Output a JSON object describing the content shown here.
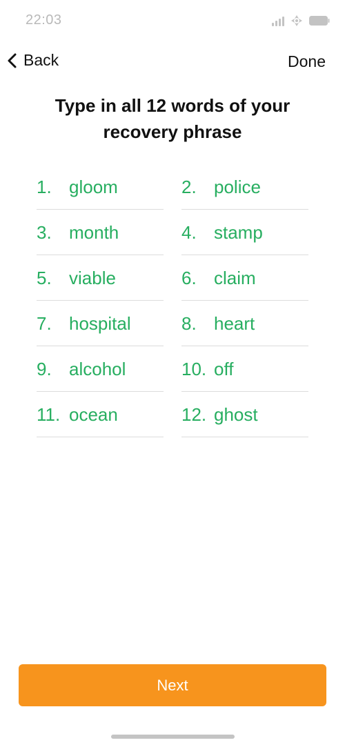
{
  "status_bar": {
    "time": "22:03"
  },
  "nav": {
    "back_label": "Back",
    "done_label": "Done"
  },
  "title": "Type in all 12 words of your recovery phrase",
  "words": [
    {
      "index": "1.",
      "word": "gloom"
    },
    {
      "index": "2.",
      "word": "police"
    },
    {
      "index": "3.",
      "word": "month"
    },
    {
      "index": "4.",
      "word": "stamp"
    },
    {
      "index": "5.",
      "word": "viable"
    },
    {
      "index": "6.",
      "word": "claim"
    },
    {
      "index": "7.",
      "word": "hospital"
    },
    {
      "index": "8.",
      "word": "heart"
    },
    {
      "index": "9.",
      "word": "alcohol"
    },
    {
      "index": "10.",
      "word": "off"
    },
    {
      "index": "11.",
      "word": "ocean"
    },
    {
      "index": "12.",
      "word": "ghost"
    }
  ],
  "next_label": "Next",
  "colors": {
    "accent_green": "#27ae60",
    "button_orange": "#f7941d",
    "text_dark": "#111111",
    "status_grey": "#b9b9b9"
  },
  "icons": {
    "back": "chevron-left-icon",
    "signal": "cellular-signal-icon",
    "wifi": "wifi-icon",
    "battery": "battery-icon"
  }
}
